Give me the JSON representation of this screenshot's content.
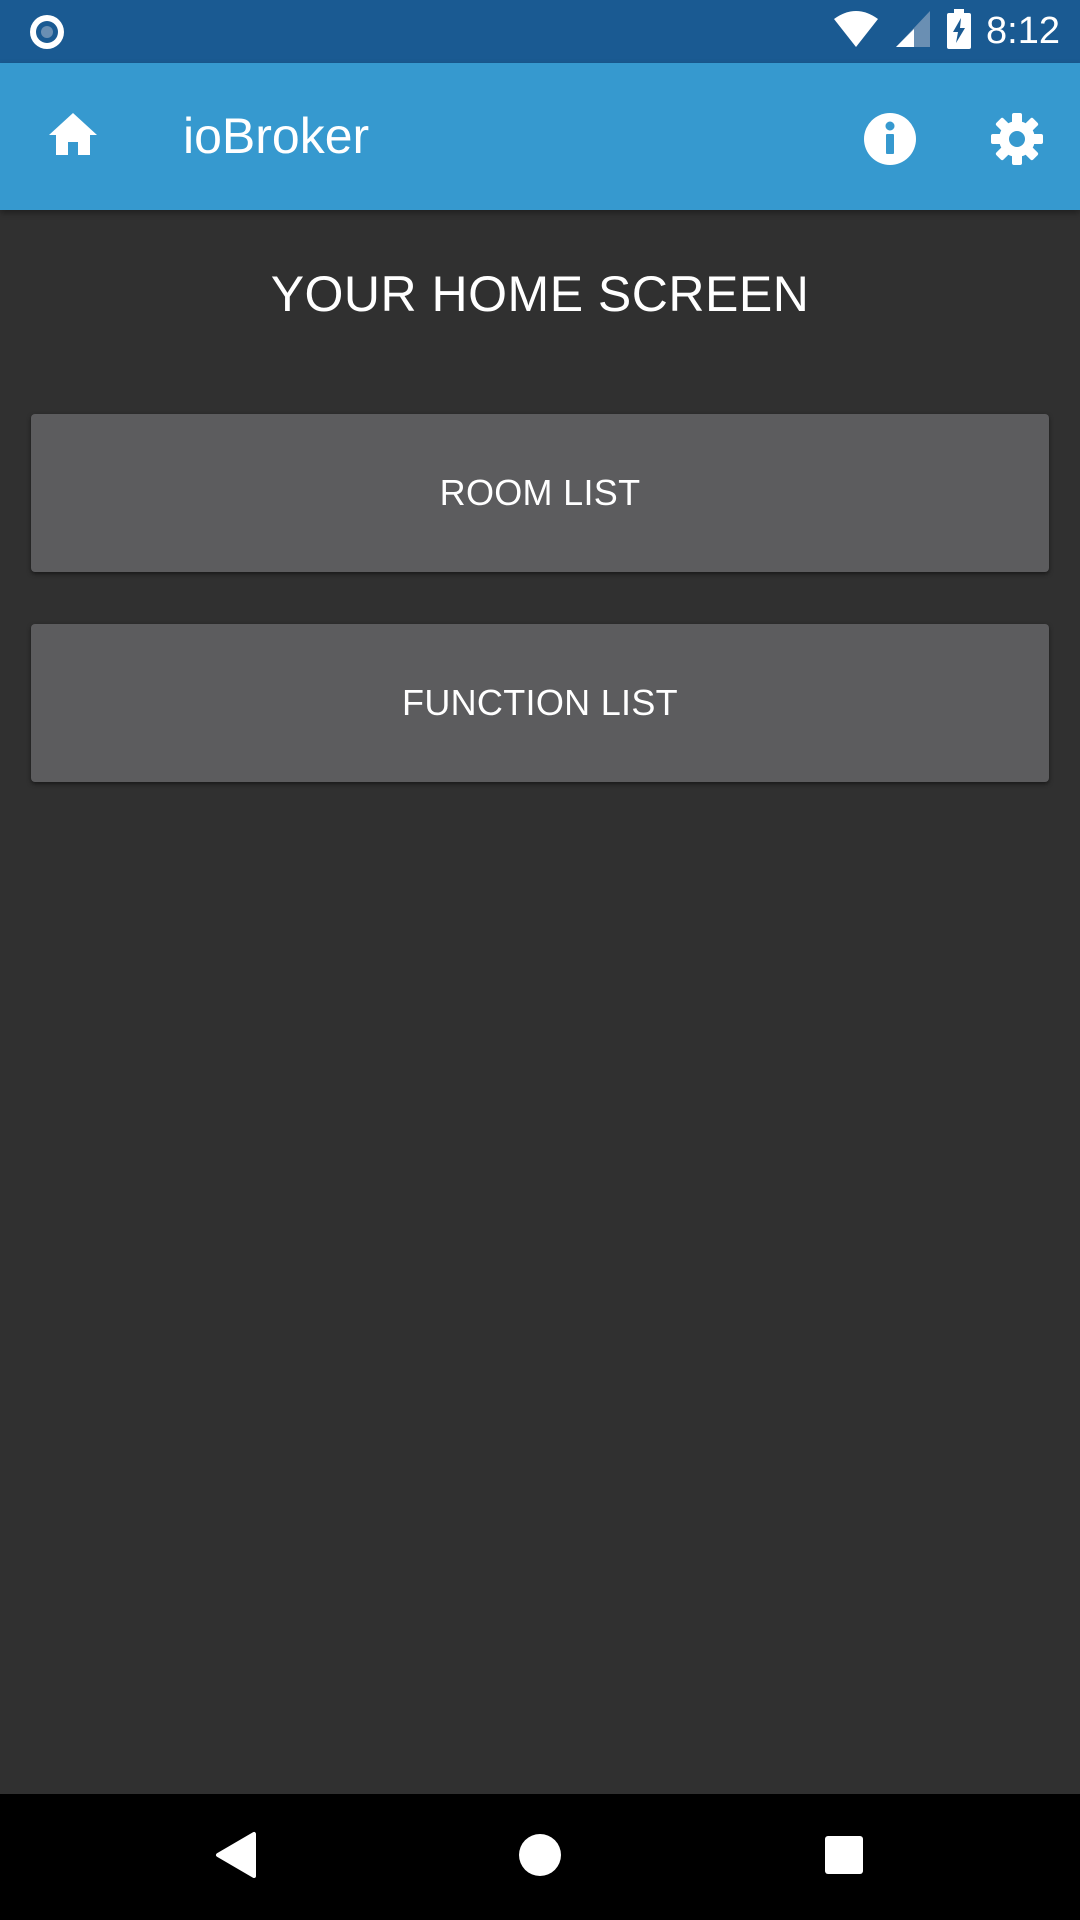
{
  "status_bar": {
    "time": "8:12",
    "left_icon": "notification-circle-icon",
    "icons": [
      "wifi-icon",
      "cell-signal-icon",
      "battery-charging-icon"
    ]
  },
  "app_bar": {
    "title": "ioBroker",
    "home_icon": "home-icon",
    "info_icon": "info-icon",
    "settings_icon": "gear-icon",
    "color": "#3699cf"
  },
  "main": {
    "heading": "YOUR HOME SCREEN",
    "buttons": [
      {
        "label": "ROOM LIST"
      },
      {
        "label": "FUNCTION LIST"
      }
    ]
  },
  "nav_bar": {
    "icons": [
      "back-icon",
      "home-circle-icon",
      "recents-icon"
    ]
  },
  "colors": {
    "status_bar": "#1a5a92",
    "background": "#303030",
    "button": "#5c5c5e",
    "text": "#ffffff"
  }
}
